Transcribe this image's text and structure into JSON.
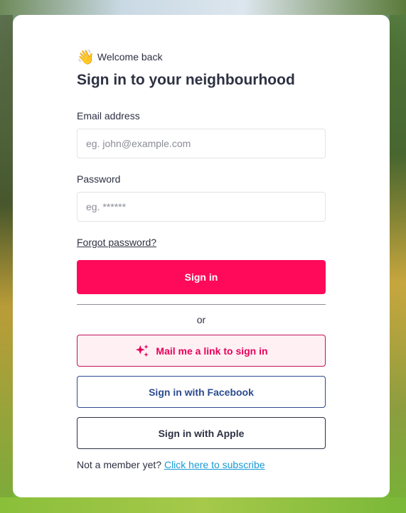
{
  "welcome": {
    "icon": "waving-hand-icon",
    "emoji": "👋",
    "greeting": "Welcome back",
    "title": "Sign in to your neighbourhood"
  },
  "form": {
    "email_label": "Email address",
    "email_placeholder": "eg. john@example.com",
    "email_value": "",
    "password_label": "Password",
    "password_placeholder": "eg. ******",
    "password_value": "",
    "forgot_label": "Forgot password?"
  },
  "actions": {
    "signin_label": "Sign in",
    "or_label": "or",
    "magic_link_icon": "sparkles-icon",
    "magic_link_label": "Mail me a link to sign in",
    "facebook_label": "Sign in with Facebook",
    "apple_label": "Sign in with Apple"
  },
  "footer": {
    "prompt": "Not a member yet?",
    "subscribe_label": "Click here to subscribe"
  },
  "colors": {
    "primary": "#ff0a5a",
    "text": "#2d3142",
    "facebook": "#2b4b8f",
    "link": "#1a9ad6",
    "magic_bg": "#fff0f4"
  }
}
